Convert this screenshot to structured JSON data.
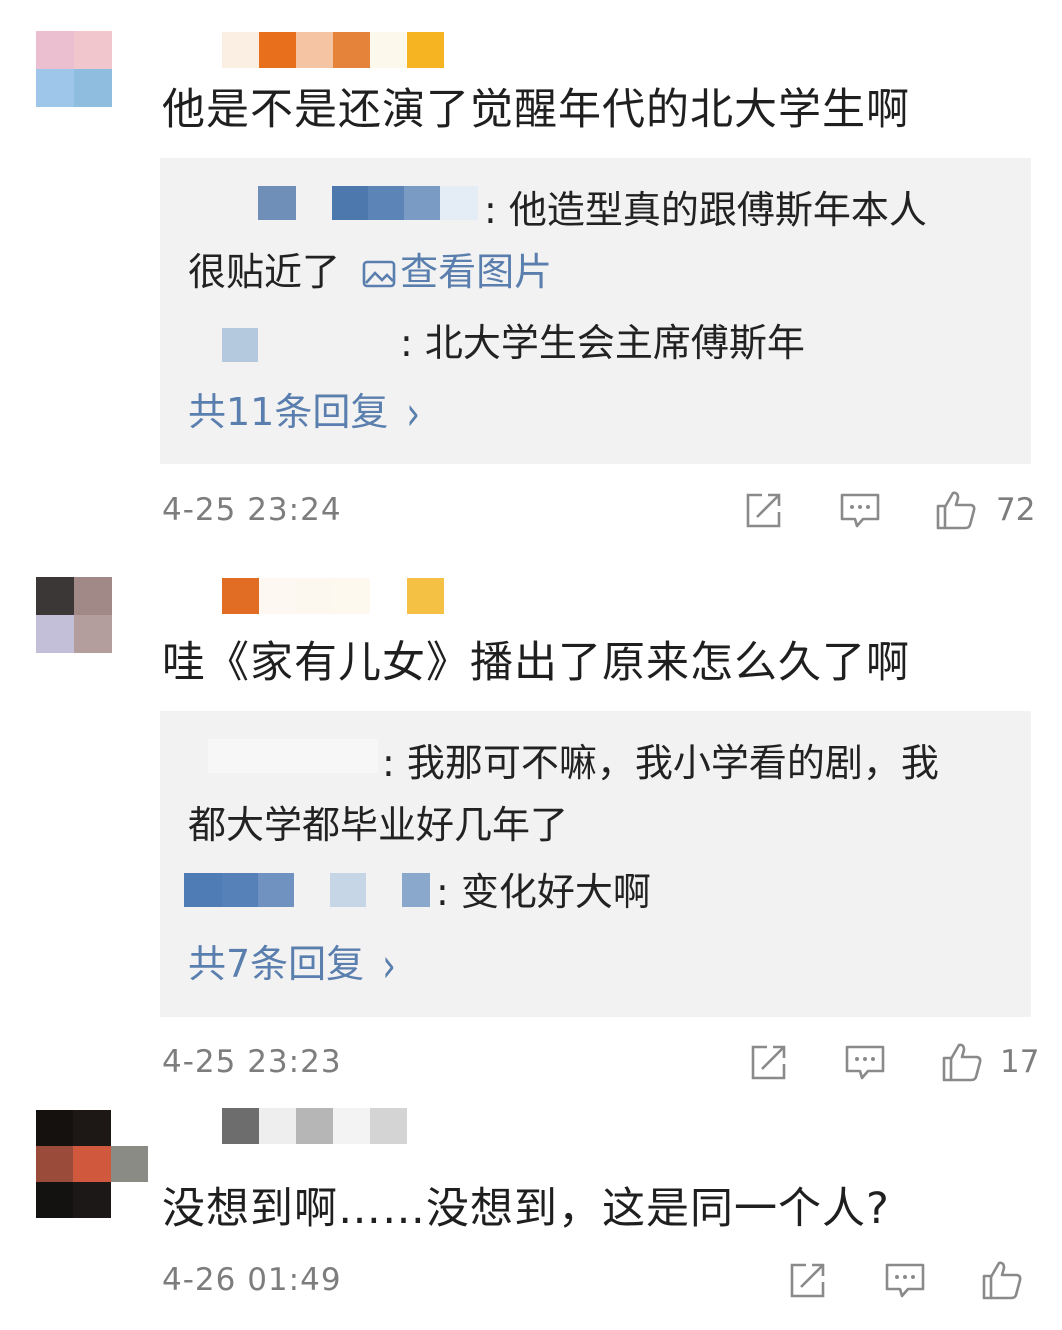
{
  "comments": [
    {
      "text": "他是不是还演了觉醒年代的北大学生啊",
      "replies": [
        {
          "separator": ":",
          "text": "他造型真的跟傅斯年本人",
          "text2": "很贴近了",
          "link": "查看图片"
        },
        {
          "separator": ":",
          "text": "北大学生会主席傅斯年"
        }
      ],
      "more_label": "共11条回复",
      "time": "4-25 23:24",
      "likes": "72"
    },
    {
      "text": "哇《家有儿女》播出了原来怎么久了啊",
      "replies": [
        {
          "separator": ":",
          "text": "我那可不嘛，我小学看的剧，我",
          "text2": "都大学都毕业好几年了"
        },
        {
          "separator": ":",
          "text": "变化好大啊"
        }
      ],
      "more_label": "共7条回复",
      "time": "4-25 23:23",
      "likes": "17"
    },
    {
      "text": "没想到啊……没想到，这是同一个人?",
      "time": "4-26 01:49",
      "likes": ""
    }
  ],
  "icons": {
    "share": "share-icon",
    "comment": "comment-icon",
    "like": "thumbs-up-icon",
    "image": "image-icon"
  },
  "colors": {
    "link": "#5a7fae",
    "reply_bg": "#f2f2f2",
    "meta": "#7d7d7d"
  }
}
